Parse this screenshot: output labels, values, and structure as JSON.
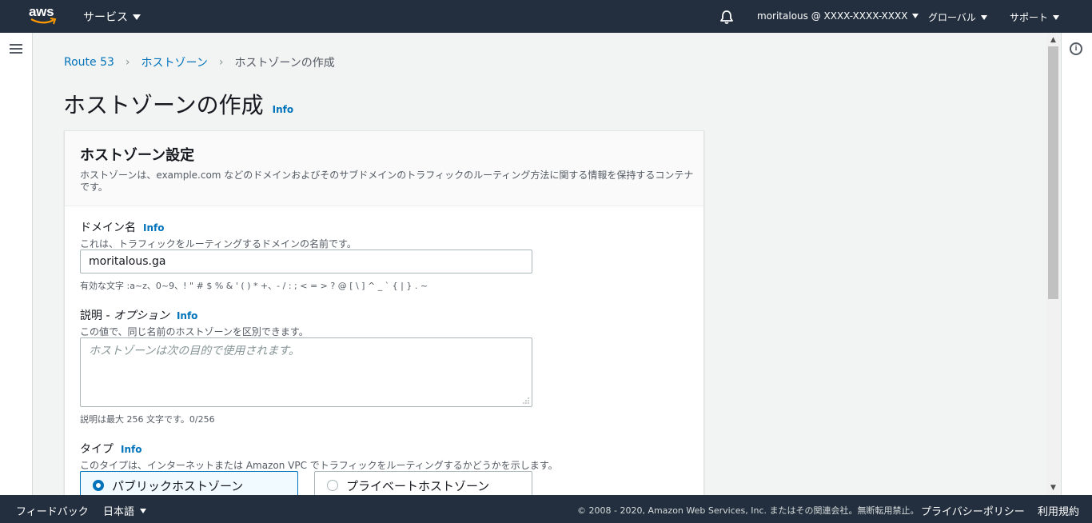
{
  "topbar": {
    "logo_text": "aws",
    "services_label": "サービス",
    "account_label": "moritalous @ XXXX-XXXX-XXXX",
    "region_label": "グローバル",
    "support_label": "サポート",
    "icons": [
      "bell-icon",
      "caret-down-icon"
    ]
  },
  "breadcrumb": {
    "items": [
      "Route 53",
      "ホストゾーン",
      "ホストゾーンの作成"
    ]
  },
  "page": {
    "title": "ホストゾーンの作成",
    "info": "Info"
  },
  "panel": {
    "title": "ホストゾーン設定",
    "description": "ホストゾーンは、example.com などのドメインおよびそのサブドメインのトラフィックのルーティング方法に関する情報を保持するコンテナです。"
  },
  "domain": {
    "label": "ドメイン名",
    "info": "Info",
    "description": "これは、トラフィックをルーティングするドメインの名前です。",
    "value": "moritalous.ga",
    "hint": "有効な文字 :a~z、0~9、! \" # $ % & ' ( ) * +、- / : ; < = > ? @ [ \\ ] ^ _ ` { | } . ~"
  },
  "comment": {
    "label": "説明 - ",
    "label_optional": "オプション",
    "info": "Info",
    "description": "この値で、同じ名前のホストゾーンを区別できます。",
    "placeholder": "ホストゾーンは次の目的で使用されます。",
    "hint": "説明は最大 256 文字です。0/256"
  },
  "type": {
    "label": "タイプ",
    "info": "Info",
    "description": "このタイプは、インターネットまたは Amazon VPC でトラフィックをルーティングするかどうかを示します。",
    "options": [
      "パブリックホストゾーン",
      "プライベートホストゾーン"
    ],
    "selected": "パブリックホストゾーン"
  },
  "footer": {
    "feedback": "フィードバック",
    "language": "日本語",
    "copyright": "© 2008 - 2020, Amazon Web Services, Inc. またはその関連会社。無断転用禁止。",
    "privacy": "プライバシーポリシー",
    "terms": "利用規約"
  },
  "colors": {
    "header_bg": "#232f3e",
    "link": "#0073bb",
    "page_bg": "#f2f3f3"
  }
}
